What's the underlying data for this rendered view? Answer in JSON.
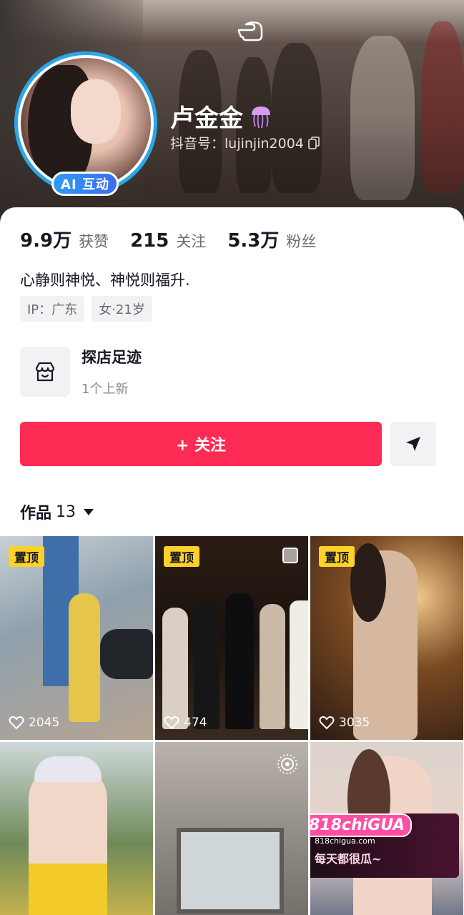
{
  "profile": {
    "username": "卢金金",
    "douyin_id": "抖音号：lujinjin2004",
    "ai_badge": "AI 互动"
  },
  "stats": [
    {
      "value": "9.9万",
      "label": "获赞"
    },
    {
      "value": "215",
      "label": "关注"
    },
    {
      "value": "5.3万",
      "label": "粉丝"
    }
  ],
  "bio": "心静则神悦、神悦则福升.",
  "tags": [
    "IP：广东",
    "女·21岁"
  ],
  "shop": {
    "title": "探店足迹",
    "subtitle": "1个上新"
  },
  "actions": {
    "follow_label": "+ 关注"
  },
  "works": {
    "label": "作品",
    "count": "13"
  },
  "videos": [
    {
      "pinned": "置顶",
      "likes": "2045"
    },
    {
      "pinned": "置顶",
      "likes": "474"
    },
    {
      "pinned": "置顶",
      "likes": "3035"
    },
    {
      "pinned": "",
      "likes": ""
    },
    {
      "pinned": "",
      "likes": ""
    },
    {
      "pinned": "",
      "likes": ""
    }
  ],
  "ad": {
    "logo": "818chiGUA",
    "url": "818chigua.com",
    "slogan": "每天都很瓜~"
  },
  "colors": {
    "accent": "#fe2c55",
    "pin": "#fcd12a",
    "avatar_ring": "#29a7e8"
  }
}
